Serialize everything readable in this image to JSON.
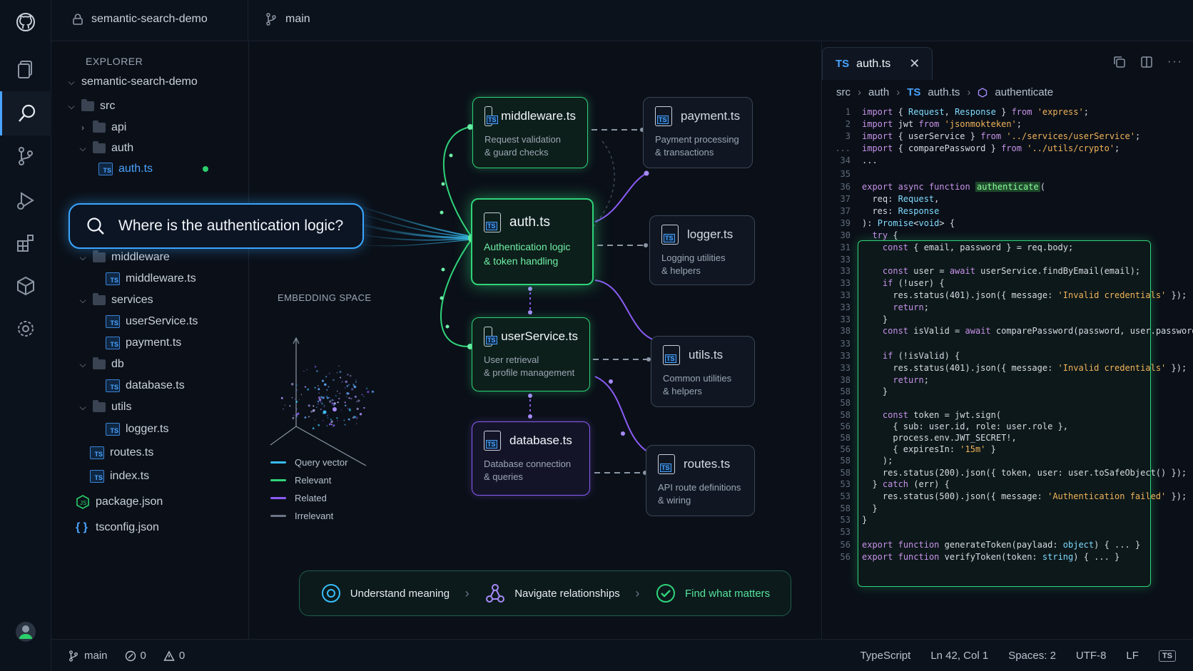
{
  "topbar": {
    "repo": "semantic-search-demo",
    "branch": "main"
  },
  "explorer": {
    "title": "EXPLORER",
    "root": "semantic-search-demo",
    "rows": [
      {
        "label": "src"
      },
      {
        "label": "api"
      },
      {
        "label": "auth"
      },
      {
        "label": "auth.ts"
      },
      {
        "label": "middleware"
      },
      {
        "label": "middleware.ts"
      },
      {
        "label": "services"
      },
      {
        "label": "userService.ts"
      },
      {
        "label": "payment.ts"
      },
      {
        "label": "db"
      },
      {
        "label": "database.ts"
      },
      {
        "label": "utils"
      },
      {
        "label": "logger.ts"
      },
      {
        "label": "routes.ts"
      },
      {
        "label": "index.ts"
      },
      {
        "label": "package.json"
      },
      {
        "label": "tsconfig.json"
      }
    ]
  },
  "search": {
    "query": "Where is the authentication logic?"
  },
  "graph": {
    "nodes": [
      {
        "title": "middleware.ts",
        "desc1": "Request validation",
        "desc2": "& guard checks"
      },
      {
        "title": "auth.ts",
        "desc1": "Authentication logic",
        "desc2": "& token handling"
      },
      {
        "title": "userService.ts",
        "desc1": "User retrieval",
        "desc2": "& profile management"
      },
      {
        "title": "database.ts",
        "desc1": "Database connection",
        "desc2": "& queries"
      },
      {
        "title": "payment.ts",
        "desc1": "Payment processing",
        "desc2": "& transactions"
      },
      {
        "title": "logger.ts",
        "desc1": "Logging utilities",
        "desc2": "& helpers"
      },
      {
        "title": "utils.ts",
        "desc1": "Common utilities",
        "desc2": "& helpers"
      },
      {
        "title": "routes.ts",
        "desc1": "API route definitions",
        "desc2": "& wiring"
      }
    ],
    "embedding_title": "EMBEDDING SPACE",
    "legend": [
      {
        "label": "Query vector",
        "color": "#38bdf8"
      },
      {
        "label": "Relevant",
        "color": "#2fd37a"
      },
      {
        "label": "Related",
        "color": "#8b5cf6"
      },
      {
        "label": "Irrelevant",
        "color": "#6b7686"
      }
    ],
    "features": [
      {
        "label": "Understand meaning"
      },
      {
        "label": "Navigate relationships"
      },
      {
        "label": "Find what matters"
      }
    ]
  },
  "editor": {
    "tab_icon": "TS",
    "tab_label": "auth.ts",
    "breadcrumbs": [
      "src",
      "auth",
      "auth.ts",
      "authenticate"
    ],
    "lines": [
      {
        "n": "1",
        "t": "import { Request, Response } from 'express';"
      },
      {
        "n": "2",
        "t": "import jwt from 'jsonmokteken';"
      },
      {
        "n": "3",
        "t": "import { userService } from '../services/userService';"
      },
      {
        "n": "...",
        "t": "import { comparePassword } from '../utils/crypto';"
      },
      {
        "n": "34",
        "t": "..."
      },
      {
        "n": "35",
        "t": ""
      },
      {
        "n": "36",
        "t": "export async function authenticate("
      },
      {
        "n": "37",
        "t": "  req: Request,"
      },
      {
        "n": "37",
        "t": "  res: Response"
      },
      {
        "n": "39",
        "t": "): Promise<void> {"
      },
      {
        "n": "30",
        "t": "  try {"
      },
      {
        "n": "31",
        "t": "    const { email, password } = req.body;"
      },
      {
        "n": "33",
        "t": ""
      },
      {
        "n": "33",
        "t": "    const user = await userService.findByEmail(email);"
      },
      {
        "n": "33",
        "t": "    if (!user) {"
      },
      {
        "n": "33",
        "t": "      res.status(401).json({ message: 'Invalid credentials' });"
      },
      {
        "n": "33",
        "t": "      return;"
      },
      {
        "n": "33",
        "t": "    }"
      },
      {
        "n": "38",
        "t": "    const isValid = await comparePassword(password, user.passwordHash);"
      },
      {
        "n": "33",
        "t": ""
      },
      {
        "n": "33",
        "t": "    if (!isValid) {"
      },
      {
        "n": "33",
        "t": "      res.status(401).json({ message: 'Invalid credentials' });"
      },
      {
        "n": "38",
        "t": "      return;"
      },
      {
        "n": "58",
        "t": "    }"
      },
      {
        "n": "58",
        "t": ""
      },
      {
        "n": "58",
        "t": "    const token = jwt.sign("
      },
      {
        "n": "56",
        "t": "      { sub: user.id, role: user.role },"
      },
      {
        "n": "58",
        "t": "      process.env.JWT_SECRET!,"
      },
      {
        "n": "56",
        "t": "      { expiresIn: '15m' }"
      },
      {
        "n": "58",
        "t": "    );"
      },
      {
        "n": "58",
        "t": "    res.status(200).json({ token, user: user.toSafeObject() });"
      },
      {
        "n": "53",
        "t": "  } catch (err) {"
      },
      {
        "n": "53",
        "t": "    res.status(500).json({ message: 'Authentication failed' });"
      },
      {
        "n": "58",
        "t": "  }"
      },
      {
        "n": "53",
        "t": "}"
      },
      {
        "n": "53",
        "t": ""
      },
      {
        "n": "56",
        "t": "export function generateToken(paylaad: object) { ... }"
      },
      {
        "n": "56",
        "t": "export function verifyToken(token: string) { ... }"
      }
    ]
  },
  "status": {
    "branch": "main",
    "errors": "0",
    "warnings": "0",
    "language": "TypeScript",
    "position": "Ln 42, Col 1",
    "spaces": "Spaces: 2",
    "encoding": "UTF-8",
    "eol": "LF",
    "lang_badge": "TS"
  }
}
